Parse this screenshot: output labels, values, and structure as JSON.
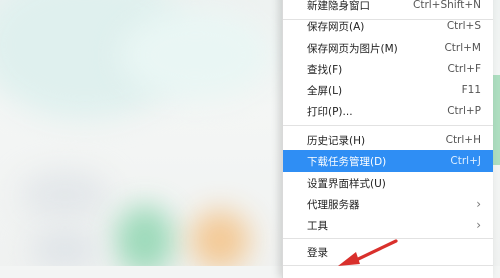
{
  "menu": {
    "items": [
      {
        "label": "新建隐身窗口",
        "shortcut": "Ctrl+Shift+N"
      },
      {
        "label": "保存网页(A)",
        "shortcut": "Ctrl+S"
      },
      {
        "label": "保存网页为图片(M)",
        "shortcut": "Ctrl+M"
      },
      {
        "label": "查找(F)",
        "shortcut": "Ctrl+F"
      },
      {
        "label": "全屏(L)",
        "shortcut": "F11"
      },
      {
        "label": "打印(P)...",
        "shortcut": "Ctrl+P"
      },
      {
        "label": "历史记录(H)",
        "shortcut": "Ctrl+H"
      },
      {
        "label": "下载任务管理(D)",
        "shortcut": "Ctrl+J"
      },
      {
        "label": "设置界面样式(U)",
        "shortcut": ""
      },
      {
        "label": "代理服务器",
        "shortcut": ""
      },
      {
        "label": "工具",
        "shortcut": ""
      },
      {
        "label": "登录",
        "shortcut": ""
      }
    ],
    "submenu_chevron": "›"
  },
  "colors": {
    "highlight": "#2f8ef4",
    "arrow": "#d9302c"
  },
  "icons": [
    "chevron-right-icon",
    "red-arrow-annotation"
  ]
}
